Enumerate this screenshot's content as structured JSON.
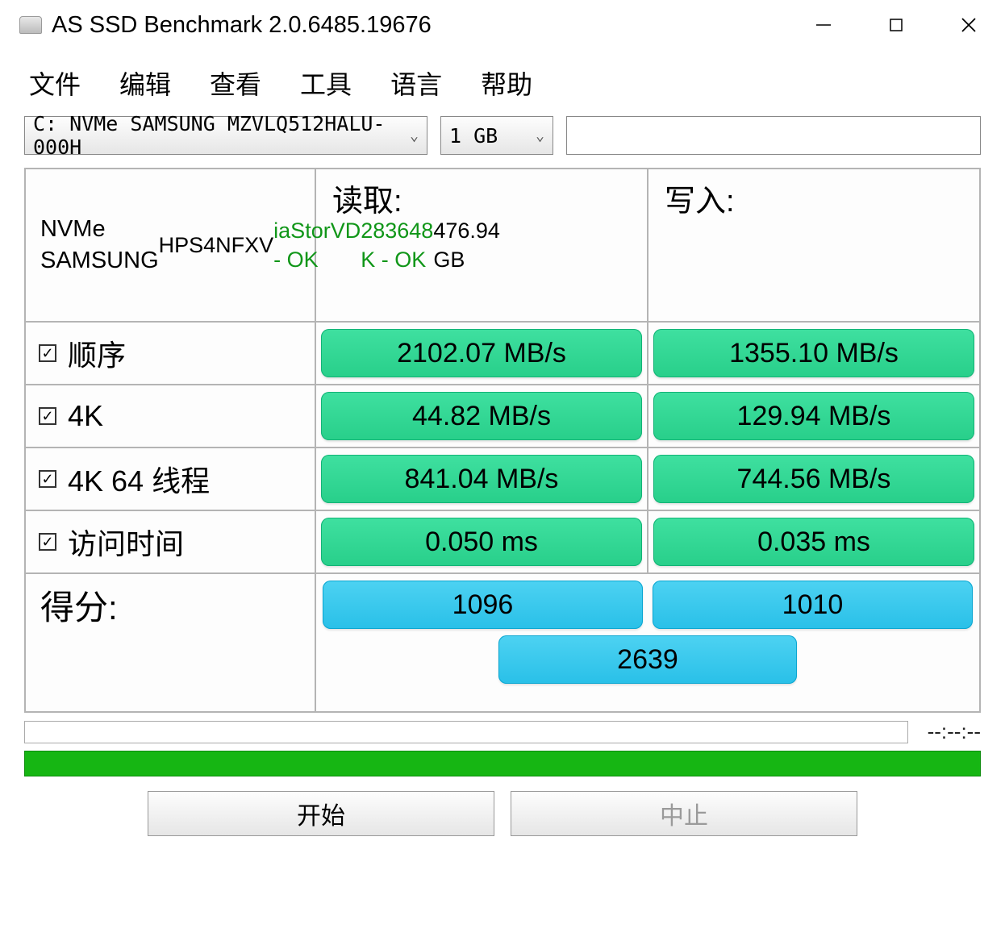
{
  "window": {
    "title": "AS SSD Benchmark 2.0.6485.19676"
  },
  "menu": {
    "file": "文件",
    "edit": "编辑",
    "view": "查看",
    "tools": "工具",
    "language": "语言",
    "help": "帮助"
  },
  "toolbar": {
    "drive_selected": "C: NVMe SAMSUNG MZVLQ512HALU-000H",
    "size_selected": "1 GB"
  },
  "info": {
    "model": "NVMe SAMSUNG",
    "serial": "HPS4NFXV",
    "driver_status": "iaStorVD - OK",
    "alignment_status": "283648 K - OK",
    "capacity": "476.94 GB"
  },
  "headers": {
    "read": "读取:",
    "write": "写入:",
    "score": "得分:"
  },
  "tests": {
    "seq": {
      "label": "顺序",
      "read": "2102.07 MB/s",
      "write": "1355.10 MB/s"
    },
    "4k": {
      "label": "4K",
      "read": "44.82 MB/s",
      "write": "129.94 MB/s"
    },
    "4k64": {
      "label": "4K 64 线程",
      "read": "841.04 MB/s",
      "write": "744.56 MB/s"
    },
    "access": {
      "label": "访问时间",
      "read": "0.050 ms",
      "write": "0.035 ms"
    }
  },
  "score": {
    "read": "1096",
    "write": "1010",
    "total": "2639"
  },
  "progress": {
    "time": "--:--:--"
  },
  "buttons": {
    "start": "开始",
    "abort": "中止"
  }
}
